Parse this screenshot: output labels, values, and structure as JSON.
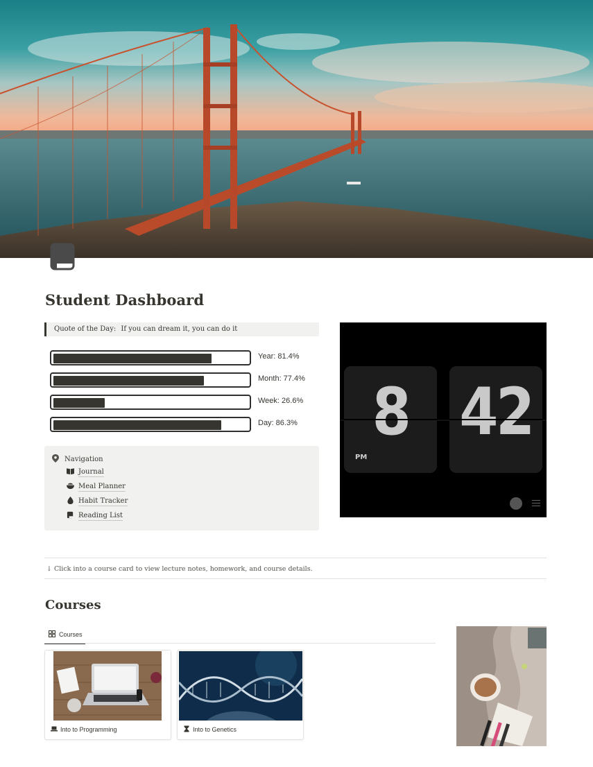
{
  "page": {
    "title": "Student Dashboard",
    "page_icon": "notebook-icon"
  },
  "quote": {
    "prefix": "Quote of the Day:",
    "text": "If you can dream it, you can do it"
  },
  "progress": [
    {
      "label": "Year: 81.4%",
      "value": 0.814
    },
    {
      "label": "Month: 77.4%",
      "value": 0.774
    },
    {
      "label": "Week: 26.6%",
      "value": 0.266
    },
    {
      "label": "Day: 86.3%",
      "value": 0.863
    }
  ],
  "navigation": {
    "heading": "Navigation",
    "icon": "map-pin-icon",
    "items": [
      {
        "label": "Journal",
        "icon": "book-open-icon"
      },
      {
        "label": "Meal Planner",
        "icon": "bowl-icon"
      },
      {
        "label": "Habit Tracker",
        "icon": "drop-icon"
      },
      {
        "label": "Reading List",
        "icon": "book-icon"
      }
    ]
  },
  "clock": {
    "hour": "8",
    "minute": "42",
    "ampm": "PM"
  },
  "hint": "↓  Click into a course card to view lecture notes, homework, and course details.",
  "courses": {
    "heading": "Courses",
    "view_tab": "Courses",
    "cards": [
      {
        "title": "Into to Programming",
        "icon": "laptop-icon"
      },
      {
        "title": "Into to Genetics",
        "icon": "hourglass-icon"
      }
    ]
  }
}
